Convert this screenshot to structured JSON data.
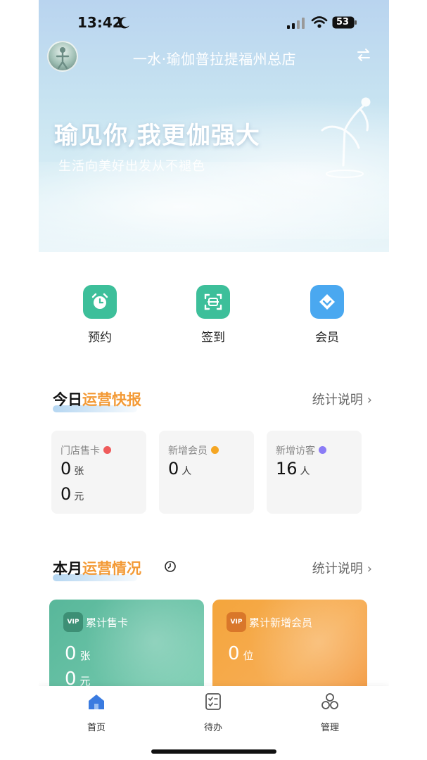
{
  "status_bar": {
    "time": "13:42",
    "battery": "53"
  },
  "header": {
    "store_name": "一水·瑜伽普拉提福州总店"
  },
  "banner": {
    "slogan": "瑜见你,我更伽强大",
    "subtitle": "生活向美好出发从不褪色"
  },
  "quick_actions": [
    {
      "label": "预约",
      "icon": "alarm-clock-icon",
      "color": "#3dbf9a"
    },
    {
      "label": "签到",
      "icon": "scan-icon",
      "color": "#3dbf9a"
    },
    {
      "label": "会员",
      "icon": "diamond-icon",
      "color": "#4aa8f0"
    }
  ],
  "today_report": {
    "title_plain": "今日",
    "title_highlight": "运营快报",
    "link": "统计说明",
    "cards": [
      {
        "label": "门店售卡",
        "dot_color": "#ef5b5b",
        "values": [
          {
            "value": "0",
            "unit": "张"
          },
          {
            "value": "0",
            "unit": "元"
          }
        ]
      },
      {
        "label": "新增会员",
        "dot_color": "#f5a623",
        "values": [
          {
            "value": "0",
            "unit": "人"
          }
        ]
      },
      {
        "label": "新增访客",
        "dot_color": "#8b7cf6",
        "values": [
          {
            "value": "16",
            "unit": "人"
          }
        ]
      }
    ]
  },
  "month_report": {
    "title_plain": "本月",
    "title_highlight": "运营情况",
    "link": "统计说明",
    "cards": [
      {
        "label": "累计售卡",
        "badge": "VIP",
        "values": [
          {
            "value": "0",
            "unit": "张"
          },
          {
            "value": "0",
            "unit": "元"
          }
        ]
      },
      {
        "label": "累计新增会员",
        "badge": "VIP",
        "values": [
          {
            "value": "0",
            "unit": "位"
          }
        ]
      }
    ]
  },
  "tabbar": [
    {
      "label": "首页",
      "icon": "home-icon",
      "active": true
    },
    {
      "label": "待办",
      "icon": "todo-icon",
      "active": false
    },
    {
      "label": "管理",
      "icon": "manage-icon",
      "active": false
    }
  ],
  "colors": {
    "accent_orange": "#f39a36",
    "active_tab": "#3a7be0"
  }
}
